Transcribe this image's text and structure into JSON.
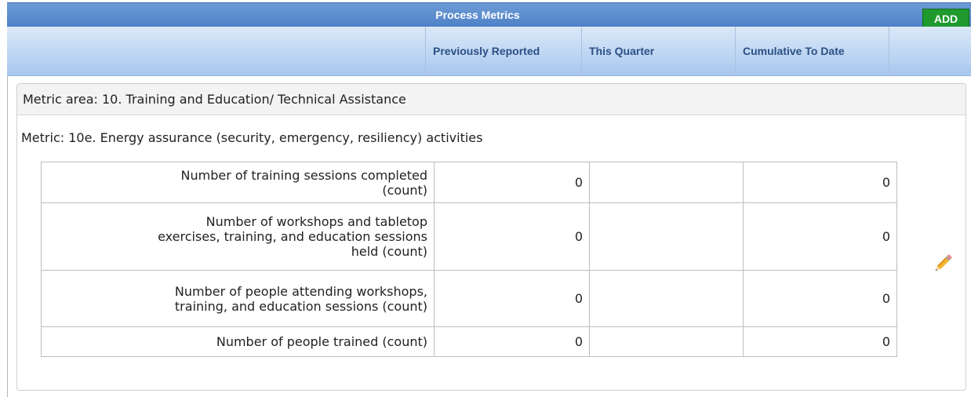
{
  "header": {
    "title": "Process Metrics",
    "add_label": "ADD",
    "columns": [
      "Previously Reported",
      "This Quarter",
      "Cumulative To Date"
    ]
  },
  "metric_area": {
    "label": "Metric area: 10. Training and Education/ Technical Assistance",
    "metric": {
      "label": "Metric: 10e. Energy assurance (security, emergency, resiliency) activities",
      "rows": [
        {
          "label_lines": [
            "Number of training sessions completed",
            "(count)"
          ],
          "previously": "0",
          "this_quarter": "",
          "cumulative": "0"
        },
        {
          "label_lines": [
            "Number of workshops and tabletop",
            "exercises, training, and education sessions",
            "held (count)"
          ],
          "previously": "0",
          "this_quarter": "",
          "cumulative": "0"
        },
        {
          "label_lines": [
            "Number of people attending workshops,",
            "training, and education sessions (count)"
          ],
          "previously": "0",
          "this_quarter": "",
          "cumulative": "0"
        },
        {
          "label_lines": [
            "Number of people trained (count)"
          ],
          "previously": "0",
          "this_quarter": "",
          "cumulative": "0"
        }
      ]
    }
  },
  "icons": {
    "edit": "pencil-icon"
  },
  "colors": {
    "header_blue": "#4f81c7",
    "add_green": "#1f9a2e",
    "column_text": "#2b4f85"
  }
}
